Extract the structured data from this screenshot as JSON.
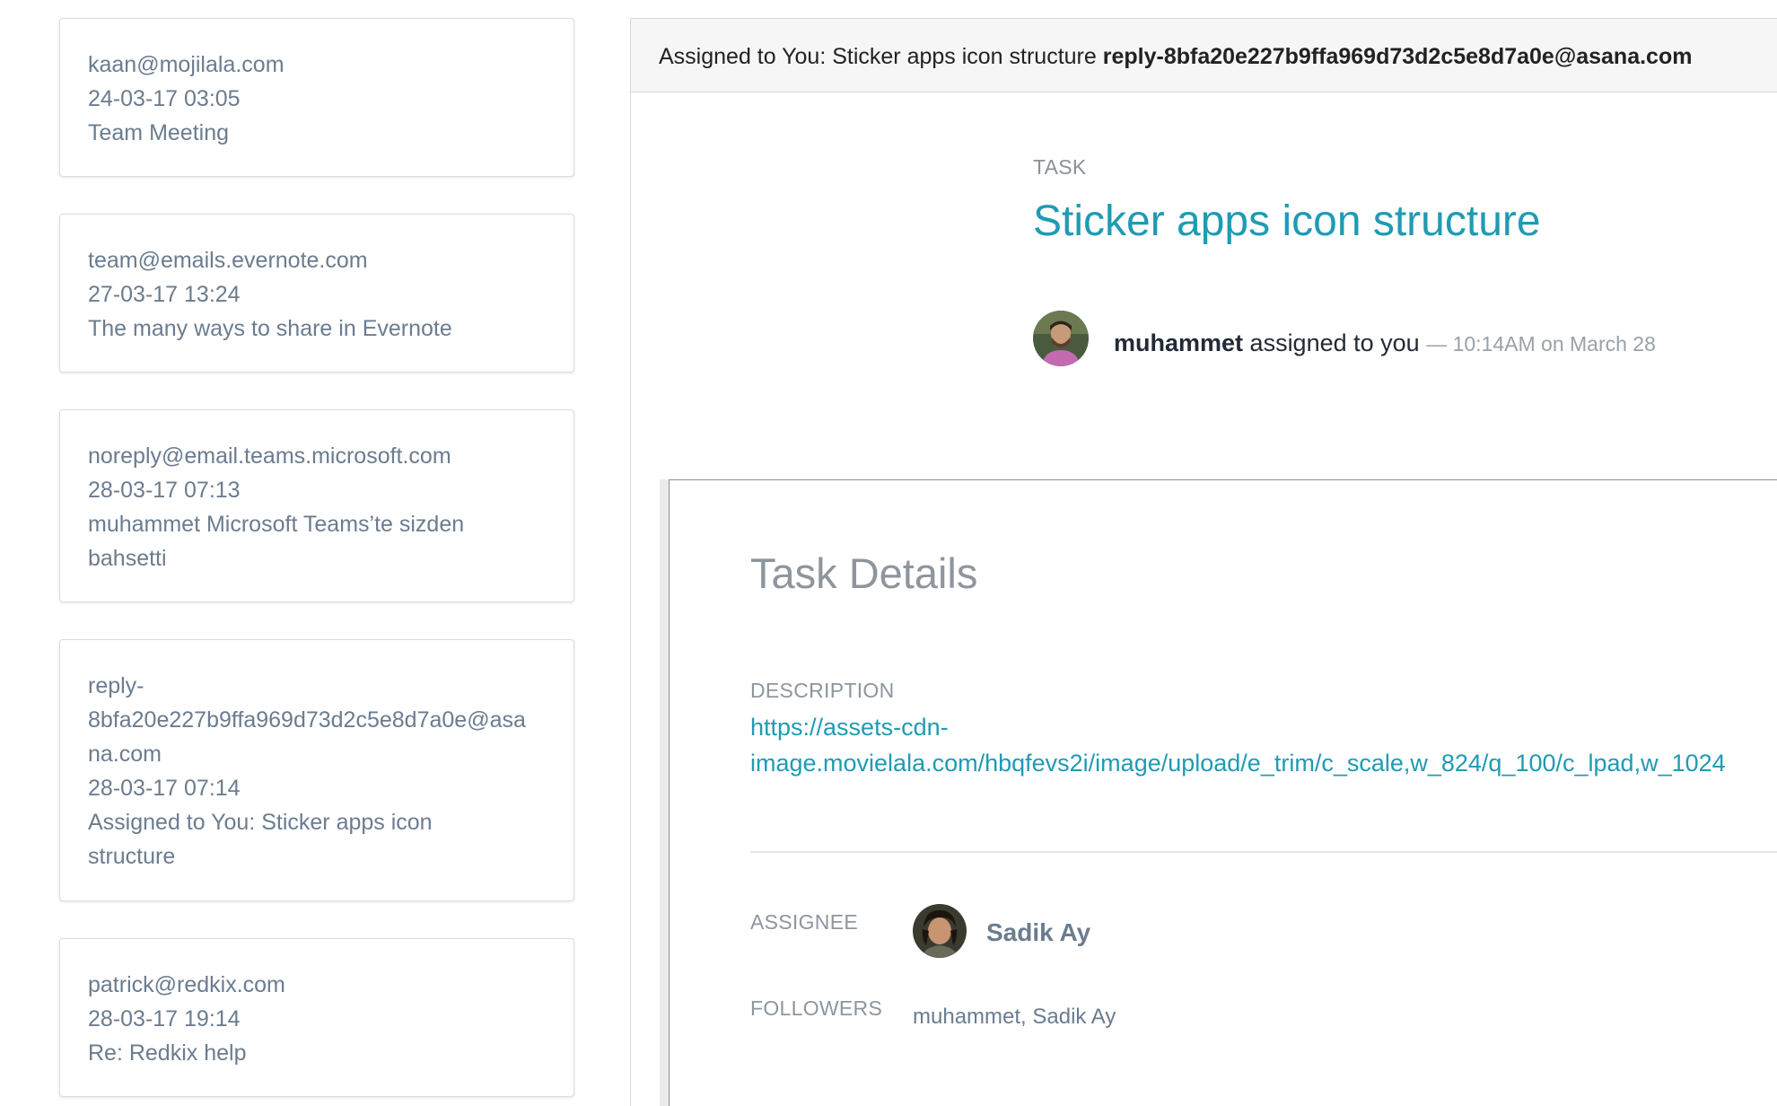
{
  "inbox": {
    "messages": [
      {
        "from": "kaan@mojilala.com",
        "date": "24-03-17 03:05",
        "subject": "Team Meeting"
      },
      {
        "from": "team@emails.evernote.com",
        "date": "27-03-17 13:24",
        "subject": "The many ways to share in Evernote"
      },
      {
        "from": "noreply@email.teams.microsoft.com",
        "date": "28-03-17 07:13",
        "subject": "muhammet Microsoft Teams’te sizden bahsetti"
      },
      {
        "from": "reply-8bfa20e227b9ffa969d73d2c5e8d7a0e@asana.com",
        "date": "28-03-17 07:14",
        "subject": "Assigned to You: Sticker apps icon structure"
      },
      {
        "from": "patrick@redkix.com",
        "date": "28-03-17 19:14",
        "subject": "Re: Redkix help"
      }
    ]
  },
  "email": {
    "subject": "Assigned to You: Sticker apps icon structure",
    "from_address": "reply-8bfa20e227b9ffa969d73d2c5e8d7a0e@asana.com",
    "task_kicker": "TASK",
    "task_title": "Sticker apps icon structure",
    "activity": {
      "actor": "muhammet",
      "action": "assigned to you",
      "meta": "— 10:14AM on March 28"
    },
    "details": {
      "title": "Task Details",
      "description_label": "DESCRIPTION",
      "description_link": "https://assets-cdn-\nimage.movielala.com/hbqfevs2i/image/upload/e_trim/c_scale,w_824/q_100/c_lpad,w_1024",
      "assignee_label": "ASSIGNEE",
      "assignee_name": "Sadik Ay",
      "followers_label": "FOLLOWERS",
      "followers_value": "muhammet, Sadik Ay"
    }
  },
  "colors": {
    "link": "#1f9bb3",
    "muted_text": "#6b7c8f",
    "label_gray": "#8d969e"
  },
  "icons": {
    "activity_avatar": "user-photo-avatar",
    "assignee_avatar": "user-photo-avatar"
  }
}
